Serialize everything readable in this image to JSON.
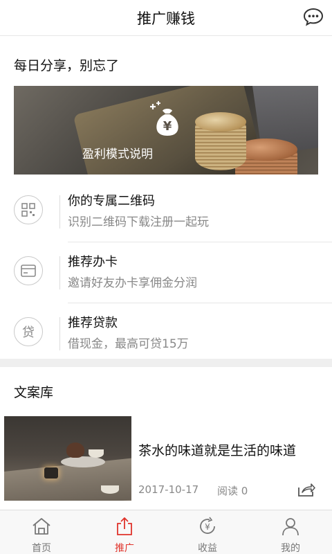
{
  "header": {
    "title": "推广赚钱",
    "message_icon": "chat-bubble-icon"
  },
  "daily": {
    "title": "每日分享，别忘了"
  },
  "banner": {
    "caption": "盈利模式说明",
    "icon": "money-bag-icon"
  },
  "menu": [
    {
      "title": "你的专属二维码",
      "subtitle": "识别二维码下载注册一起玩",
      "icon": "qrcode-icon"
    },
    {
      "title": "推荐办卡",
      "subtitle": "邀请好友办卡享佣金分润",
      "icon": "card-icon"
    },
    {
      "title": "推荐贷款",
      "subtitle": "借现金，最高可贷15万",
      "icon": "loan-icon",
      "icon_text": "贷"
    }
  ],
  "library": {
    "title": "文案库",
    "articles": [
      {
        "title": "茶水的味道就是生活的味道",
        "date": "2017-10-17",
        "reads": "阅读 0",
        "share_icon": "share-icon"
      }
    ]
  },
  "tabbar": {
    "active_color": "#e0332b",
    "tabs": [
      {
        "label": "首页",
        "icon": "home-icon"
      },
      {
        "label": "推广",
        "icon": "upload-share-icon",
        "active": true
      },
      {
        "label": "收益",
        "icon": "income-icon"
      },
      {
        "label": "我的",
        "icon": "person-icon"
      }
    ]
  }
}
